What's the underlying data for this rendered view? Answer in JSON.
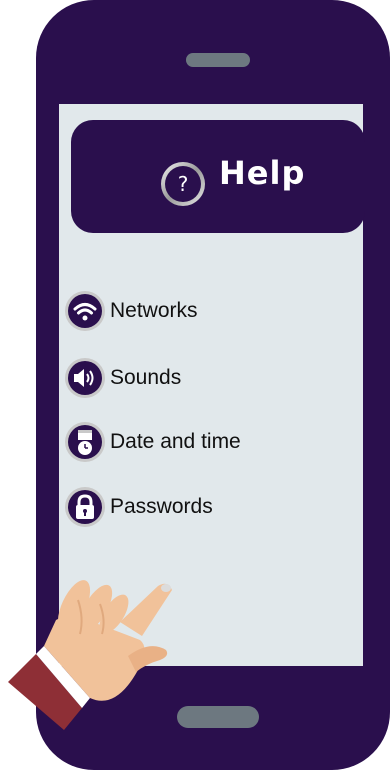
{
  "header": {
    "title": "Help",
    "icon_glyph": "?"
  },
  "menu": {
    "items": [
      {
        "label": "Networks",
        "icon": "wifi-icon"
      },
      {
        "label": "Sounds",
        "icon": "speaker-icon"
      },
      {
        "label": "Date and time",
        "icon": "clock-calendar-icon"
      },
      {
        "label": "Passwords",
        "icon": "padlock-icon"
      }
    ]
  },
  "colors": {
    "phone_body": "#2a0f4d",
    "screen_bg": "#e1e8eb",
    "speaker": "#6d7880",
    "icon_bg": "#2a0f4d",
    "icon_ring": "#c9c9c9",
    "sleeve": "#8e2f36",
    "skin": "#f1c29a"
  }
}
